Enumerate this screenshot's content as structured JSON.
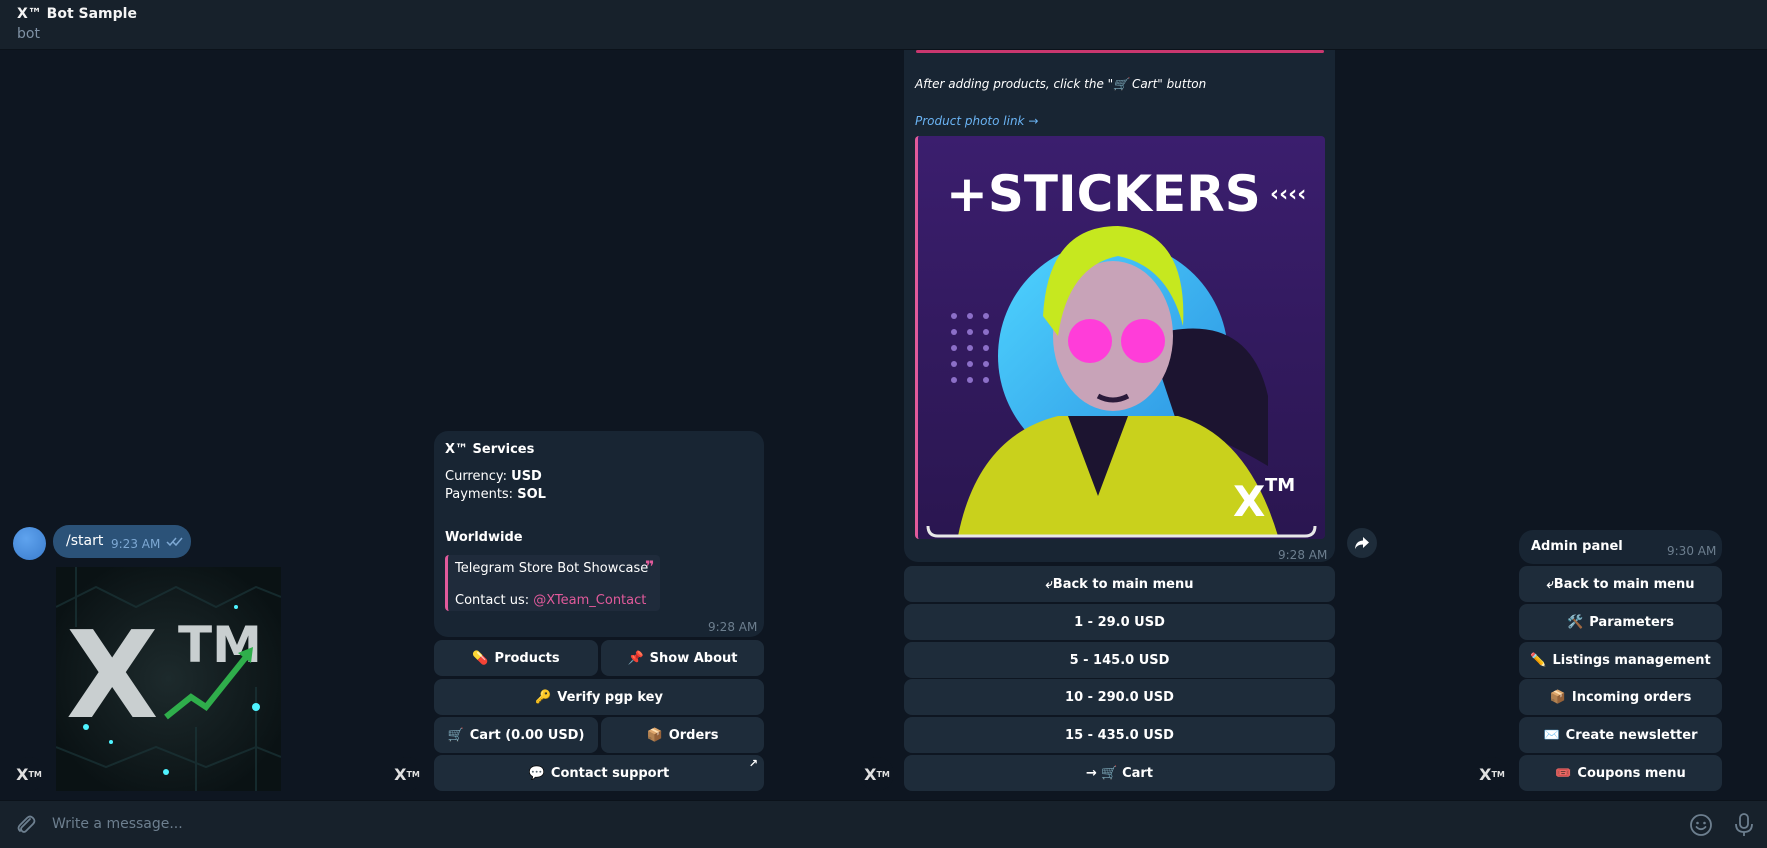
{
  "header": {
    "title": "X™ Bot Sample",
    "subtitle": "bot"
  },
  "composer": {
    "placeholder": "Write a message..."
  },
  "avatar": {
    "label": "X",
    "sup": "TM"
  },
  "outgoing": {
    "text": "/start",
    "time": "9:23 AM"
  },
  "logo_image": {
    "big": "X",
    "tm": "TM"
  },
  "services": {
    "title": "X™ Services",
    "currency_label": "Currency: ",
    "currency_value": "USD",
    "payments_label": "Payments: ",
    "payments_value": "SOL",
    "region": "Worldwide",
    "quote_line1": "Telegram Store Bot Showcase",
    "quote_mark": "❞",
    "quote_line2_prefix": "Contact us: ",
    "quote_mention": "@XTeam_Contact",
    "time": "9:28 AM",
    "buttons": {
      "products": "Products",
      "products_emoji": "💊",
      "show_about": "Show About",
      "show_about_emoji": "📌",
      "verify": "Verify pgp key",
      "verify_emoji": "🔑",
      "cart": "Cart (0.00 USD)",
      "cart_emoji": "🛒",
      "orders": "Orders",
      "orders_emoji": "📦",
      "support": "Contact support",
      "support_emoji": "💬",
      "support_arrow": "↗"
    }
  },
  "product": {
    "caption": "After adding products, click the \"🛒 Cart\" button",
    "photo_link": "Product photo link →",
    "photo_title": "+STICKERS",
    "photo_chevrons": "‹‹‹‹",
    "photo_mark": "X",
    "photo_mark_sup": "TM",
    "time": "9:28 AM",
    "buttons": {
      "back": "⤶Back to main menu",
      "opt1": "1 - 29.0 USD",
      "opt2": "5 - 145.0 USD",
      "opt3": "10 - 290.0 USD",
      "opt4": "15 - 435.0 USD",
      "cart": "→ 🛒 Cart"
    }
  },
  "admin": {
    "title": "Admin panel",
    "time": "9:30 AM",
    "buttons": {
      "back": "⤶Back to main menu",
      "parameters": "Parameters",
      "parameters_emoji": "🛠️",
      "listings": "Listings management",
      "listings_emoji": "✏️",
      "incoming": "Incoming orders",
      "incoming_emoji": "📦",
      "newsletter": "Create newsletter",
      "newsletter_emoji": "✉️",
      "coupons": "Coupons menu",
      "coupons_emoji": "🎟️"
    }
  },
  "colors": {
    "background": "#0e1621",
    "panel": "#17212b",
    "bubble_in": "#182533",
    "bubble_out": "#2b5278",
    "button": "#1e2c3a",
    "accent_pink": "#e15a9b",
    "link_blue": "#6ab3f3"
  }
}
